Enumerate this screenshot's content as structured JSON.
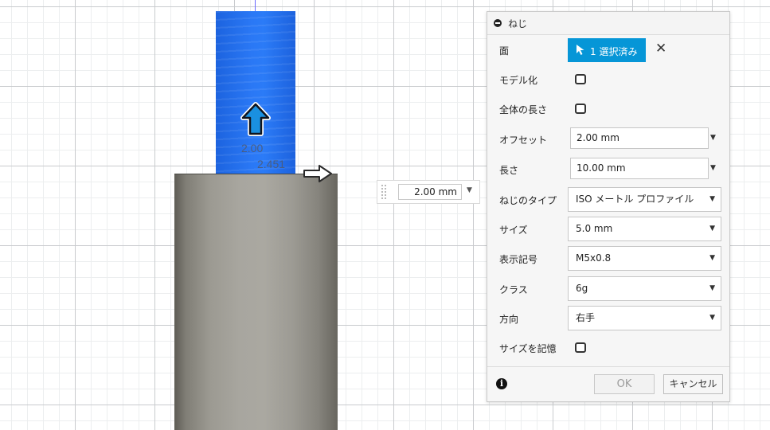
{
  "canvas": {
    "ghost_value_a": "2.00",
    "ghost_value_b": "2.451",
    "offset_input": {
      "value": "2.00 mm"
    }
  },
  "dialog": {
    "title": "ねじ",
    "rows": {
      "face": {
        "label": "面",
        "button_label": "1 選択済み"
      },
      "modeled": {
        "label": "モデル化",
        "checked": false
      },
      "full_length": {
        "label": "全体の長さ",
        "checked": false
      },
      "offset": {
        "label": "オフセット",
        "value": "2.00 mm"
      },
      "length": {
        "label": "長さ",
        "value": "10.00 mm"
      },
      "thread_type": {
        "label": "ねじのタイプ",
        "value": "ISO メートル プロファイル"
      },
      "size": {
        "label": "サイズ",
        "value": "5.0 mm"
      },
      "designation": {
        "label": "表示記号",
        "value": "M5x0.8"
      },
      "class": {
        "label": "クラス",
        "value": "6g"
      },
      "direction": {
        "label": "方向",
        "value": "右手"
      },
      "remember_size": {
        "label": "サイズを記憶",
        "checked": false
      }
    },
    "ok_label": "OK",
    "cancel_label": "キャンセル"
  },
  "colors": {
    "accent": "#0696d7",
    "thread_preview": "#2a78f5",
    "body_gray": "#a8a69f"
  },
  "icons": {
    "collapse": "minus-circle-icon",
    "cursor": "cursor-arrow-icon",
    "clear": "close-icon",
    "info": "info-icon",
    "manipulator_up": "arrow-up-icon",
    "manipulator_right": "arrow-right-icon"
  }
}
